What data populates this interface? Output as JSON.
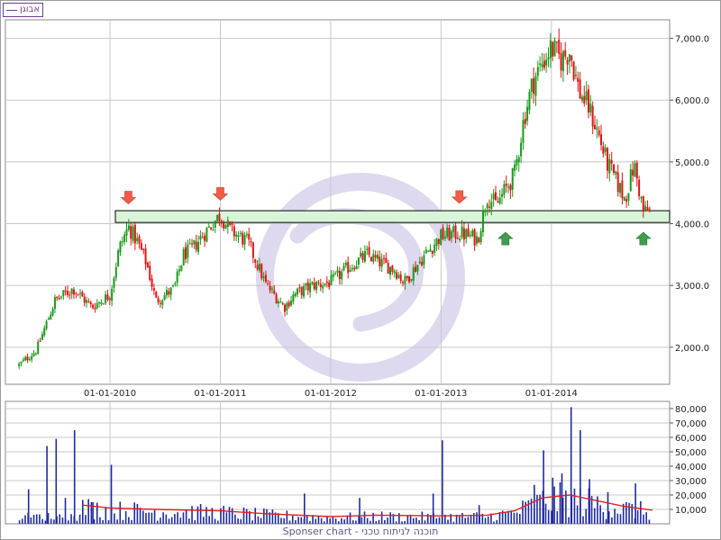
{
  "legend": {
    "label": "אבוגן"
  },
  "footer": {
    "text": "Sponser chart - תוכנה לניתוח טכני"
  },
  "colors": {
    "up": "#1a9a1a",
    "down": "#e11414",
    "volume": "#1f2ba0",
    "volume_ma": "#e02020",
    "band_fill": "#d9f5d9",
    "grid": "#c8c8c8",
    "arrow_down": "#f25a4a",
    "arrow_up": "#3e9e4e",
    "watermark": "#d8d2ec"
  },
  "chart_data": [
    {
      "type": "candlestick",
      "x_axis": {
        "ticks": [
          "01-01-2010",
          "01-01-2011",
          "01-01-2012",
          "01-01-2013",
          "01-01-2014"
        ]
      },
      "y_axis": {
        "ticks": [
          "2,000.0",
          "3,000.0",
          "4,000.0",
          "5,000.0",
          "6,000.0",
          "7,000.0"
        ],
        "ylim": [
          1400,
          7300
        ]
      },
      "price_anchors": [
        {
          "date": "2009-03",
          "close": 1700
        },
        {
          "date": "2009-05",
          "close": 1950
        },
        {
          "date": "2009-07",
          "close": 2750
        },
        {
          "date": "2009-09",
          "close": 2950
        },
        {
          "date": "2009-11",
          "close": 2650
        },
        {
          "date": "2010-01",
          "close": 2850
        },
        {
          "date": "2010-02",
          "close": 3600
        },
        {
          "date": "2010-03",
          "close": 3950
        },
        {
          "date": "2010-04",
          "close": 3700
        },
        {
          "date": "2010-05",
          "close": 3350
        },
        {
          "date": "2010-06",
          "close": 2750
        },
        {
          "date": "2010-08",
          "close": 2950
        },
        {
          "date": "2010-09",
          "close": 3500
        },
        {
          "date": "2010-10",
          "close": 3600
        },
        {
          "date": "2010-11",
          "close": 3800
        },
        {
          "date": "2011-01",
          "close": 4150
        },
        {
          "date": "2011-02",
          "close": 3900
        },
        {
          "date": "2011-04",
          "close": 3700
        },
        {
          "date": "2011-05",
          "close": 3350
        },
        {
          "date": "2011-06",
          "close": 3000
        },
        {
          "date": "2011-08",
          "close": 2650
        },
        {
          "date": "2011-09",
          "close": 2850
        },
        {
          "date": "2011-11",
          "close": 3000
        },
        {
          "date": "2012-01",
          "close": 3050
        },
        {
          "date": "2012-03",
          "close": 3300
        },
        {
          "date": "2012-05",
          "close": 3500
        },
        {
          "date": "2012-06",
          "close": 3400
        },
        {
          "date": "2012-08",
          "close": 3250
        },
        {
          "date": "2012-09",
          "close": 3050
        },
        {
          "date": "2012-11",
          "close": 3450
        },
        {
          "date": "2013-01",
          "close": 3800
        },
        {
          "date": "2013-03",
          "close": 3850
        },
        {
          "date": "2013-05",
          "close": 3750
        },
        {
          "date": "2013-06",
          "close": 4450
        },
        {
          "date": "2013-07",
          "close": 4300
        },
        {
          "date": "2013-08",
          "close": 4550
        },
        {
          "date": "2013-09",
          "close": 4800
        },
        {
          "date": "2013-10",
          "close": 5700
        },
        {
          "date": "2013-11",
          "close": 6300
        },
        {
          "date": "2013-12",
          "close": 6600
        },
        {
          "date": "2014-01",
          "close": 6850
        },
        {
          "date": "2014-02",
          "close": 6650
        },
        {
          "date": "2014-03",
          "close": 6800
        },
        {
          "date": "2014-04",
          "close": 6150
        },
        {
          "date": "2014-05",
          "close": 5900
        },
        {
          "date": "2014-06",
          "close": 5500
        },
        {
          "date": "2014-07",
          "close": 5000
        },
        {
          "date": "2014-08",
          "close": 4700
        },
        {
          "date": "2014-09",
          "close": 4400
        },
        {
          "date": "2014-10",
          "close": 4950
        },
        {
          "date": "2014-11",
          "close": 4200
        }
      ],
      "support_band": {
        "low": 4020,
        "high": 4210
      },
      "annotations": [
        {
          "type": "arrow-down",
          "date": "2010-03",
          "price": 4320
        },
        {
          "type": "arrow-down",
          "date": "2011-01",
          "price": 4380
        },
        {
          "type": "arrow-down",
          "date": "2013-03",
          "price": 4330
        },
        {
          "type": "arrow-up",
          "date": "2013-08",
          "price": 3860
        },
        {
          "type": "arrow-up",
          "date": "2014-11",
          "price": 3860
        }
      ]
    },
    {
      "type": "bar",
      "name": "volume",
      "y_axis": {
        "ticks": [
          "10,000",
          "20,000",
          "30,000",
          "40,000",
          "50,000",
          "60,000",
          "70,000",
          "80,000"
        ],
        "ylim": [
          0,
          85000
        ]
      },
      "spikes": [
        {
          "date": "2009-04",
          "value": 24000
        },
        {
          "date": "2009-06",
          "value": 54000
        },
        {
          "date": "2009-07",
          "value": 59000
        },
        {
          "date": "2009-08",
          "value": 18000
        },
        {
          "date": "2009-09",
          "value": 65000
        },
        {
          "date": "2009-11",
          "value": 15000
        },
        {
          "date": "2010-01",
          "value": 41000
        },
        {
          "date": "2011-10",
          "value": 21000
        },
        {
          "date": "2012-04",
          "value": 18000
        },
        {
          "date": "2012-12",
          "value": 21000
        },
        {
          "date": "2013-01",
          "value": 58000
        },
        {
          "date": "2013-05",
          "value": 13000
        },
        {
          "date": "2013-11",
          "value": 27000
        },
        {
          "date": "2013-12",
          "value": 51000
        },
        {
          "date": "2014-01",
          "value": 32000
        },
        {
          "date": "2014-02",
          "value": 35000
        },
        {
          "date": "2014-03",
          "value": 81000
        },
        {
          "date": "2014-04",
          "value": 65000
        },
        {
          "date": "2014-05",
          "value": 31000
        },
        {
          "date": "2014-07",
          "value": 22000
        },
        {
          "date": "2014-10",
          "value": 28000
        }
      ],
      "moving_average": [
        {
          "date": "2009-10",
          "value": 13000
        },
        {
          "date": "2010-01",
          "value": 11000
        },
        {
          "date": "2010-06",
          "value": 10000
        },
        {
          "date": "2011-01",
          "value": 9000
        },
        {
          "date": "2011-06",
          "value": 7000
        },
        {
          "date": "2012-01",
          "value": 5000
        },
        {
          "date": "2012-06",
          "value": 6000
        },
        {
          "date": "2013-01",
          "value": 5500
        },
        {
          "date": "2013-06",
          "value": 6000
        },
        {
          "date": "2013-09",
          "value": 9000
        },
        {
          "date": "2013-12",
          "value": 18000
        },
        {
          "date": "2014-03",
          "value": 20000
        },
        {
          "date": "2014-06",
          "value": 16000
        },
        {
          "date": "2014-09",
          "value": 12000
        },
        {
          "date": "2014-12",
          "value": 9500
        }
      ]
    }
  ]
}
